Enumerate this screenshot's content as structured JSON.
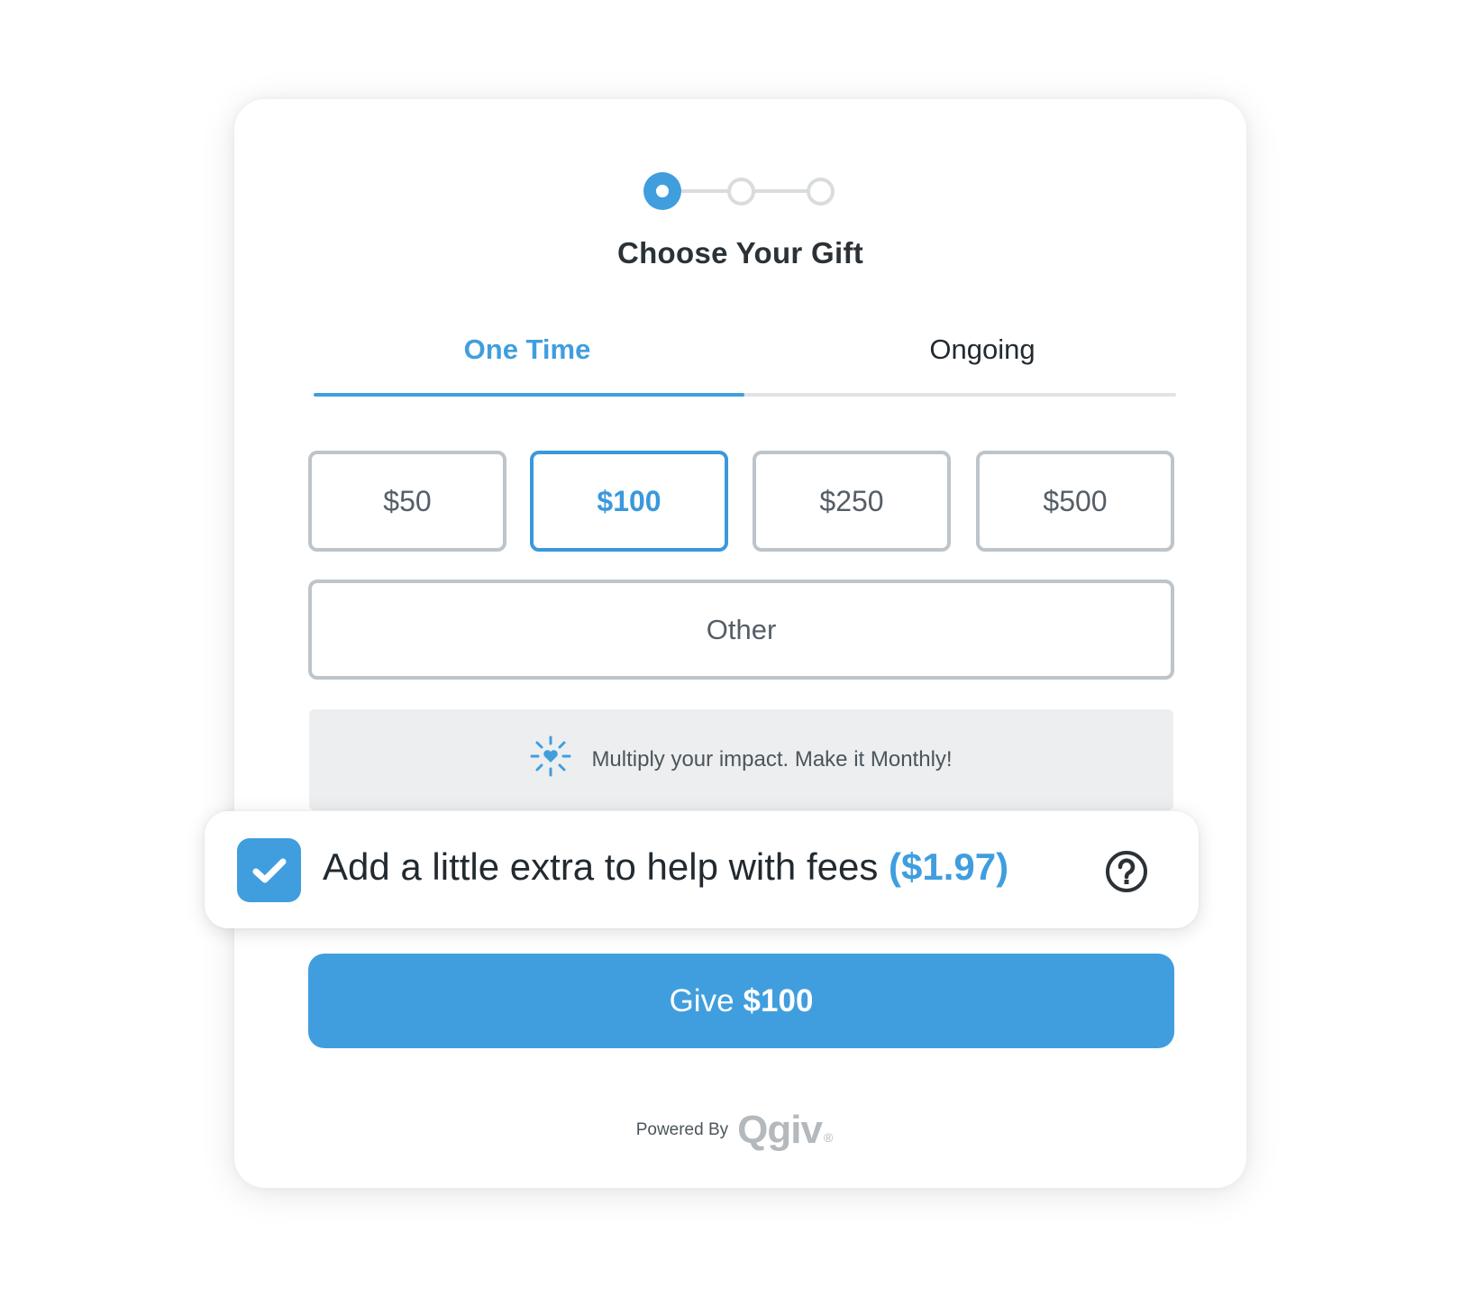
{
  "stepper": {
    "total_steps": 3,
    "current_step": 1,
    "steps": [
      {
        "state": "active"
      },
      {
        "state": "pending"
      },
      {
        "state": "pending"
      }
    ]
  },
  "page_title": "Choose Your Gift",
  "tabs": [
    {
      "label": "One Time",
      "selected": true
    },
    {
      "label": "Ongoing",
      "selected": false
    }
  ],
  "amounts": [
    {
      "label": "$50",
      "selected": false
    },
    {
      "label": "$100",
      "selected": true
    },
    {
      "label": "$250",
      "selected": false
    },
    {
      "label": "$500",
      "selected": false
    }
  ],
  "other_label": "Other",
  "promo": {
    "icon": "sparkle-heart-icon",
    "text": "Multiply your impact. Make it Monthly!"
  },
  "fee": {
    "checked": true,
    "text": "Add a little extra to help with fees",
    "amount": "($1.97)",
    "help_icon": "question-circle-icon"
  },
  "give_button": {
    "prefix": "Give",
    "amount": "$100"
  },
  "footer": {
    "powered_by": "Powered By",
    "logo_text": "Qgiv",
    "registered": "®"
  },
  "colors": {
    "accent": "#409ede",
    "border": "#bdc4ca",
    "text_dark": "#222a30",
    "promo_bg": "#edeeef"
  }
}
